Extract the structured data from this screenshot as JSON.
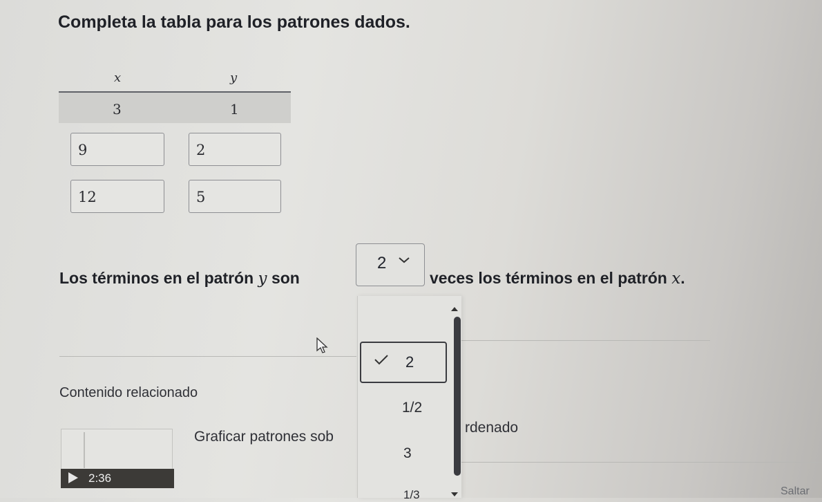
{
  "title": "Completa la tabla para los patrones dados.",
  "table": {
    "headers": [
      "x",
      "y"
    ],
    "rows": [
      {
        "x": "3",
        "y": "1"
      },
      {
        "x": "9",
        "y": "2"
      },
      {
        "x": "12",
        "y": "5"
      }
    ]
  },
  "sentence": {
    "part1": "Los términos en el patrón",
    "var1": "y",
    "part2": "son",
    "part3": "veces los términos en el patrón",
    "var2": "x",
    "end": "."
  },
  "dropdown": {
    "selected": "2",
    "options": [
      "2",
      "1/2",
      "3",
      "1/3"
    ]
  },
  "related": {
    "heading": "Contenido relacionado",
    "video_title_left": "Graficar patrones sob",
    "video_title_right": "rdenado",
    "duration": "2:36"
  },
  "skip_label": "Saltar",
  "icons": {
    "check": "check-icon",
    "chevron": "chevron-down-icon",
    "play": "play-icon",
    "cursor": "mouse-cursor-icon"
  }
}
